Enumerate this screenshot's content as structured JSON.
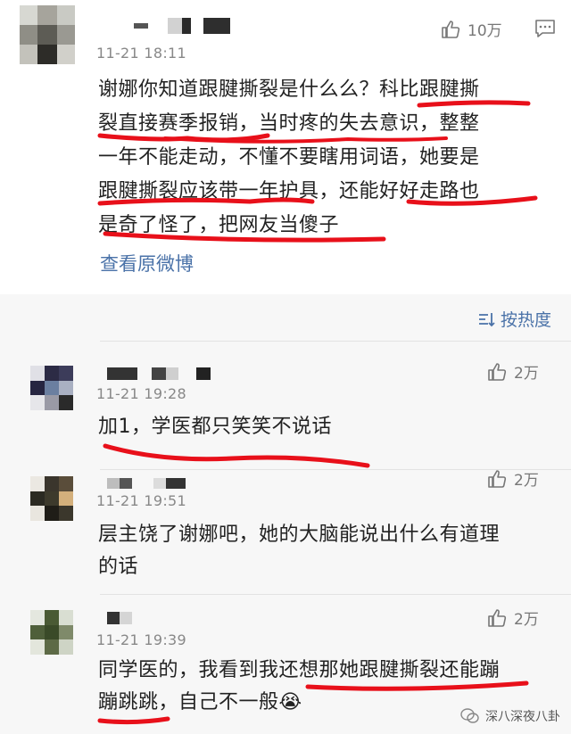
{
  "main_comment": {
    "timestamp": "11-21 18:11",
    "likes": "10万",
    "text_lines": [
      "谢娜你知道跟腱撕裂是什么么？科比跟腱撕",
      "裂直接赛季报销，当时疼的失去意识，整整",
      "一年不能走动，不懂不要瞎用词语，她要是",
      "跟腱撕裂应该带一年护具，还能好好走路也",
      "是奇了怪了，把网友当傻子"
    ],
    "view_original": "查看原微博"
  },
  "sort": {
    "label": "按热度"
  },
  "replies": [
    {
      "timestamp": "11-21 19:28",
      "likes": "2万",
      "text_lines": [
        "加1，学医都只笑笑不说话"
      ]
    },
    {
      "timestamp": "11-21 19:51",
      "likes": "2万",
      "text_lines": [
        "层主饶了谢娜吧，她的大脑能说出什么有道理",
        "的话"
      ]
    },
    {
      "timestamp": "11-21 19:39",
      "likes": "2万",
      "text_lines": [
        "同学医的，我看到我还想那她跟腱撕裂还能蹦",
        "蹦跳跳，自己不一般😭"
      ]
    }
  ],
  "watermark": {
    "text": "深八深夜八卦"
  },
  "colors": {
    "link": "#4a72a8",
    "underline": "#e8101a",
    "timestamp": "#888888"
  }
}
